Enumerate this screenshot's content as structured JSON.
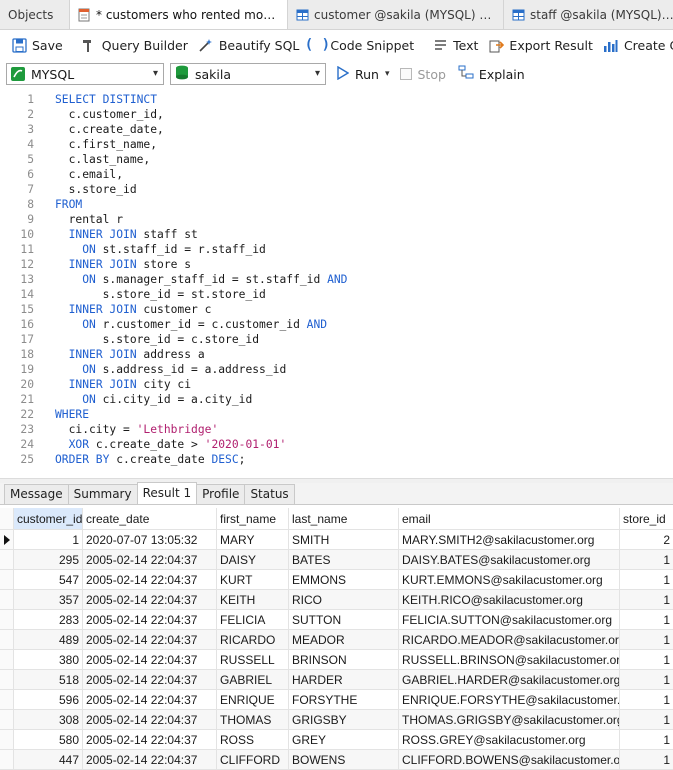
{
  "tabs": [
    {
      "label": "Objects",
      "active": false,
      "icon": "none"
    },
    {
      "label": "* customers who rented movies i...",
      "active": true,
      "icon": "query-icon"
    },
    {
      "label": "customer @sakila (MYSQL) - Table",
      "active": false,
      "icon": "table-icon"
    },
    {
      "label": "staff @sakila (MYSQL) - Table",
      "active": false,
      "icon": "table-icon"
    }
  ],
  "toolbar": {
    "save": "Save",
    "query_builder": "Query Builder",
    "beautify": "Beautify SQL",
    "snippet": "Code Snippet",
    "text": "Text",
    "export": "Export Result",
    "chart": "Create Chart"
  },
  "conn": {
    "connection": "MYSQL",
    "database": "sakila",
    "run": "Run",
    "stop": "Stop",
    "explain": "Explain"
  },
  "sql_lines": [
    [
      {
        "t": "SELECT DISTINCT",
        "c": "kw"
      }
    ],
    [
      {
        "t": "  c.customer_id,",
        "c": ""
      }
    ],
    [
      {
        "t": "  c.create_date,",
        "c": ""
      }
    ],
    [
      {
        "t": "  c.first_name,",
        "c": ""
      }
    ],
    [
      {
        "t": "  c.last_name,",
        "c": ""
      }
    ],
    [
      {
        "t": "  c.email,",
        "c": ""
      }
    ],
    [
      {
        "t": "  s.store_id",
        "c": ""
      }
    ],
    [
      {
        "t": "FROM",
        "c": "kw"
      }
    ],
    [
      {
        "t": "  rental r",
        "c": ""
      }
    ],
    [
      {
        "t": "  ",
        "c": ""
      },
      {
        "t": "INNER JOIN",
        "c": "kw"
      },
      {
        "t": " staff st",
        "c": ""
      }
    ],
    [
      {
        "t": "    ",
        "c": ""
      },
      {
        "t": "ON",
        "c": "kw"
      },
      {
        "t": " st.staff_id = r.staff_id",
        "c": ""
      }
    ],
    [
      {
        "t": "  ",
        "c": ""
      },
      {
        "t": "INNER JOIN",
        "c": "kw"
      },
      {
        "t": " store s",
        "c": ""
      }
    ],
    [
      {
        "t": "    ",
        "c": ""
      },
      {
        "t": "ON",
        "c": "kw"
      },
      {
        "t": " s.manager_staff_id = st.staff_id ",
        "c": ""
      },
      {
        "t": "AND",
        "c": "kw"
      }
    ],
    [
      {
        "t": "       s.store_id = st.store_id",
        "c": ""
      }
    ],
    [
      {
        "t": "  ",
        "c": ""
      },
      {
        "t": "INNER JOIN",
        "c": "kw"
      },
      {
        "t": " customer c",
        "c": ""
      }
    ],
    [
      {
        "t": "    ",
        "c": ""
      },
      {
        "t": "ON",
        "c": "kw"
      },
      {
        "t": " r.customer_id = c.customer_id ",
        "c": ""
      },
      {
        "t": "AND",
        "c": "kw"
      }
    ],
    [
      {
        "t": "       s.store_id = c.store_id",
        "c": ""
      }
    ],
    [
      {
        "t": "  ",
        "c": ""
      },
      {
        "t": "INNER JOIN",
        "c": "kw"
      },
      {
        "t": " address a",
        "c": ""
      }
    ],
    [
      {
        "t": "    ",
        "c": ""
      },
      {
        "t": "ON",
        "c": "kw"
      },
      {
        "t": " s.address_id = a.address_id",
        "c": ""
      }
    ],
    [
      {
        "t": "  ",
        "c": ""
      },
      {
        "t": "INNER JOIN",
        "c": "kw"
      },
      {
        "t": " city ci",
        "c": ""
      }
    ],
    [
      {
        "t": "    ",
        "c": ""
      },
      {
        "t": "ON",
        "c": "kw"
      },
      {
        "t": " ci.city_id = a.city_id",
        "c": ""
      }
    ],
    [
      {
        "t": "WHERE",
        "c": "kw"
      }
    ],
    [
      {
        "t": "  ci.city = ",
        "c": ""
      },
      {
        "t": "'Lethbridge'",
        "c": "str"
      }
    ],
    [
      {
        "t": "  ",
        "c": ""
      },
      {
        "t": "XOR",
        "c": "kw"
      },
      {
        "t": " c.create_date > ",
        "c": ""
      },
      {
        "t": "'2020-01-01'",
        "c": "str"
      }
    ],
    [
      {
        "t": "ORDER BY",
        "c": "kw"
      },
      {
        "t": " c.create_date ",
        "c": ""
      },
      {
        "t": "DESC",
        "c": "kw"
      },
      {
        "t": ";",
        "c": ""
      }
    ]
  ],
  "result_tabs": [
    "Message",
    "Summary",
    "Result 1",
    "Profile",
    "Status"
  ],
  "active_result_tab": "Result 1",
  "grid": {
    "columns": [
      "customer_id",
      "create_date",
      "first_name",
      "last_name",
      "email",
      "store_id"
    ],
    "rows": [
      [
        "1",
        "2020-07-07 13:05:32",
        "MARY",
        "SMITH",
        "MARY.SMITH2@sakilacustomer.org",
        "2"
      ],
      [
        "295",
        "2005-02-14 22:04:37",
        "DAISY",
        "BATES",
        "DAISY.BATES@sakilacustomer.org",
        "1"
      ],
      [
        "547",
        "2005-02-14 22:04:37",
        "KURT",
        "EMMONS",
        "KURT.EMMONS@sakilacustomer.org",
        "1"
      ],
      [
        "357",
        "2005-02-14 22:04:37",
        "KEITH",
        "RICO",
        "KEITH.RICO@sakilacustomer.org",
        "1"
      ],
      [
        "283",
        "2005-02-14 22:04:37",
        "FELICIA",
        "SUTTON",
        "FELICIA.SUTTON@sakilacustomer.org",
        "1"
      ],
      [
        "489",
        "2005-02-14 22:04:37",
        "RICARDO",
        "MEADOR",
        "RICARDO.MEADOR@sakilacustomer.org",
        "1"
      ],
      [
        "380",
        "2005-02-14 22:04:37",
        "RUSSELL",
        "BRINSON",
        "RUSSELL.BRINSON@sakilacustomer.org",
        "1"
      ],
      [
        "518",
        "2005-02-14 22:04:37",
        "GABRIEL",
        "HARDER",
        "GABRIEL.HARDER@sakilacustomer.org",
        "1"
      ],
      [
        "596",
        "2005-02-14 22:04:37",
        "ENRIQUE",
        "FORSYTHE",
        "ENRIQUE.FORSYTHE@sakilacustomer.org",
        "1"
      ],
      [
        "308",
        "2005-02-14 22:04:37",
        "THOMAS",
        "GRIGSBY",
        "THOMAS.GRIGSBY@sakilacustomer.org",
        "1"
      ],
      [
        "580",
        "2005-02-14 22:04:37",
        "ROSS",
        "GREY",
        "ROSS.GREY@sakilacustomer.org",
        "1"
      ],
      [
        "447",
        "2005-02-14 22:04:37",
        "CLIFFORD",
        "BOWENS",
        "CLIFFORD.BOWENS@sakilacustomer.org",
        "1"
      ]
    ]
  },
  "colors": {
    "keyword": "#1f5fd0",
    "string": "#b01e6e",
    "header_highlight": "#dbe9fb"
  }
}
